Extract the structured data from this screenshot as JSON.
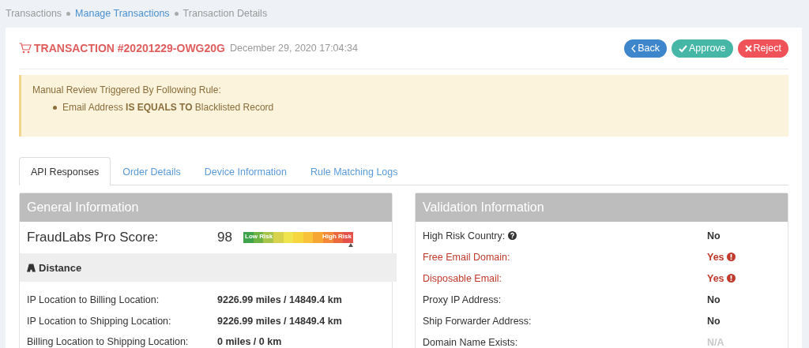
{
  "breadcrumb": [
    {
      "label": "Transactions",
      "link": false
    },
    {
      "label": "Manage Transactions",
      "link": true
    },
    {
      "label": "Transaction Details",
      "link": false
    }
  ],
  "header": {
    "title": "TRANSACTION #20201229-OWG20G",
    "date": "December 29, 2020 17:04:34"
  },
  "actions": [
    {
      "label": "Back",
      "kind": "back"
    },
    {
      "label": "Approve",
      "kind": "approve"
    },
    {
      "label": "Reject",
      "kind": "reject"
    }
  ],
  "alert": {
    "title": "Manual Review Triggered By Following Rule:",
    "rules": [
      "Email Address **IS EQUALS TO** Blacklisted Record"
    ]
  },
  "tabs": [
    {
      "label": "API Responses",
      "selected": true
    },
    {
      "label": "Order Details",
      "selected": false
    },
    {
      "label": "Device Information",
      "selected": false
    },
    {
      "label": "Rule Matching Logs",
      "selected": false
    }
  ],
  "general": {
    "title": "General Information",
    "score_label": "FraudLabs Pro Score:",
    "score": "98",
    "meter": {
      "low_label": "Low Risk",
      "high_label": "High Risk",
      "level": 0.98
    },
    "section": "Distance",
    "rows": [
      {
        "label": "IP Location to Billing Location:",
        "value": "9226.99 miles / 14849.4 km"
      },
      {
        "label": "IP Location to Shipping Location:",
        "value": "9226.99 miles / 14849.4 km"
      },
      {
        "label": "Billing Location to Shipping Location:",
        "value": "0 miles / 0 km"
      }
    ]
  },
  "validation": {
    "title": "Validation Information",
    "rows": [
      {
        "label": "High Risk Country:",
        "value": "No",
        "kind": "normal",
        "help": true
      },
      {
        "label": "Free Email Domain:",
        "value": "Yes",
        "kind": "warning",
        "help": false
      },
      {
        "label": "Disposable Email:",
        "value": "Yes",
        "kind": "warning",
        "help": false
      },
      {
        "label": "Proxy IP Address:",
        "value": "No",
        "kind": "normal",
        "help": false
      },
      {
        "label": "Ship Forwarder Address:",
        "value": "No",
        "kind": "normal",
        "help": false
      },
      {
        "label": "Domain Name Exists:",
        "value": "N/A",
        "kind": "unavailable",
        "help": false
      }
    ]
  }
}
